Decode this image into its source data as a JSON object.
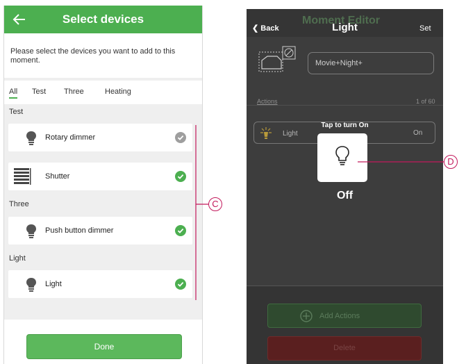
{
  "left_screen": {
    "title": "Select devices",
    "instruction": "Please select the devices you want to add to this moment.",
    "tabs": [
      "All",
      "Test",
      "Three",
      "Heating"
    ],
    "active_tab": "All",
    "sections": [
      {
        "label": "Test",
        "devices": [
          {
            "name": "Rotary dimmer",
            "icon": "bulb-icon",
            "checked_state": "gray"
          },
          {
            "name": "Shutter",
            "icon": "shutter-icon",
            "checked_state": "green"
          }
        ]
      },
      {
        "label": "Three",
        "devices": [
          {
            "name": "Push button dimmer",
            "icon": "bulb-icon",
            "checked_state": "green"
          }
        ]
      },
      {
        "label": "Light",
        "devices": [
          {
            "name": "Light",
            "icon": "bulb-icon",
            "checked_state": "green"
          }
        ]
      }
    ],
    "done_label": "Done",
    "accent_color": "#4caf50"
  },
  "right_screen": {
    "back_label": "Back",
    "ghost_title": "Moment Editor",
    "title": "Light",
    "set_label": "Set",
    "moment_name": "Movie+Night+",
    "actions_label": "Actions",
    "actions_count": "1 of 60",
    "action_row": {
      "device": "Light",
      "value": "On"
    },
    "tap_hint": "Tap to turn On",
    "state_label": "Off",
    "add_actions_label": "Add Actions",
    "delete_label": "Delete"
  },
  "callouts": {
    "c": "C",
    "d": "D"
  },
  "callout_color": "#c2185b"
}
